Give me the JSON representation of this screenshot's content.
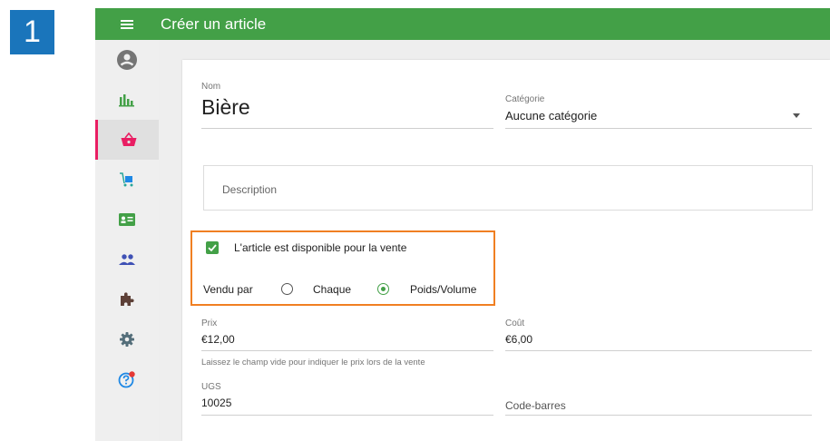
{
  "step": {
    "number": "1"
  },
  "header": {
    "title": "Créer un article"
  },
  "sidebar": {
    "items": [
      {
        "icon": "account-icon",
        "active": false
      },
      {
        "icon": "reports-icon",
        "active": false
      },
      {
        "icon": "basket-icon",
        "active": true
      },
      {
        "icon": "inventory-icon",
        "active": false
      },
      {
        "icon": "customer-card-icon",
        "active": false
      },
      {
        "icon": "employees-icon",
        "active": false
      },
      {
        "icon": "integrations-icon",
        "active": false
      },
      {
        "icon": "settings-icon",
        "active": false
      },
      {
        "icon": "help-icon",
        "active": false
      }
    ]
  },
  "form": {
    "name": {
      "label": "Nom",
      "value": "Bière"
    },
    "category": {
      "label": "Catégorie",
      "value": "Aucune catégorie"
    },
    "description": {
      "placeholder": "Description"
    },
    "available": {
      "label": "L'article est disponible pour la vente",
      "checked": true
    },
    "sold_by": {
      "label": "Vendu par",
      "options": [
        {
          "label": "Chaque",
          "selected": false
        },
        {
          "label": "Poids/Volume",
          "selected": true
        }
      ]
    },
    "price": {
      "label": "Prix",
      "value": "€12,00",
      "hint": "Laissez le champ vide pour indiquer le prix lors de la vente"
    },
    "cost": {
      "label": "Coût",
      "value": "€6,00"
    },
    "sku": {
      "label": "UGS",
      "value": "10025"
    },
    "barcode": {
      "placeholder": "Code-barres"
    }
  },
  "colors": {
    "brand": "#43a047",
    "active_marker": "#e91e63",
    "highlight_border": "#f07f22",
    "step_badge": "#1a75bb"
  }
}
